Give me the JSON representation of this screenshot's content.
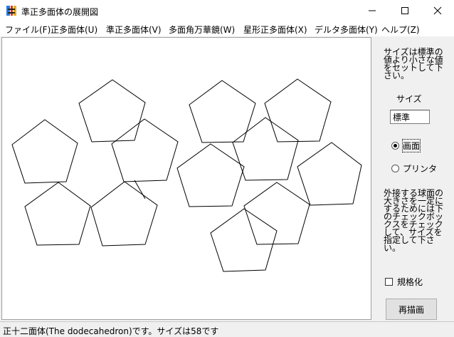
{
  "window": {
    "title": "準正多面体の展開図",
    "minimize_icon": "minimize-icon",
    "maximize_icon": "maximize-icon",
    "close_icon": "close-icon"
  },
  "menu": [
    {
      "label": "ファイル(F)"
    },
    {
      "label": "正多面体(U)"
    },
    {
      "label": "準正多面体(V)"
    },
    {
      "label": "多面角万華鏡(W)"
    },
    {
      "label": "星形正多面体(X)"
    },
    {
      "label": "デルタ多面体(Y)"
    },
    {
      "label": "ヘルプ(Z)"
    }
  ],
  "panel": {
    "size_hint": "サイズは標準の値より小さな値をセットして下さい。",
    "size_label": "サイズ",
    "size_value": "標準",
    "output_options": [
      {
        "label": "画面",
        "checked": true
      },
      {
        "label": "プリンタ",
        "checked": false
      }
    ],
    "normalize_hint": "外接する球面の大きさを一定にするためには下のチェックボックスをチェックして、サイズを指定して下さい。",
    "normalize_label": "規格化",
    "normalize_checked": false,
    "redraw_label": "再描画"
  },
  "status": {
    "text": "正十二面体(The dodecahedron)です。サイズは58です"
  },
  "net": {
    "shape": "dodecahedron",
    "face_count": 12,
    "edge_length": 58
  },
  "colors": {
    "line": "#000000",
    "canvas": "#ffffff",
    "panel": "#f0f0f0"
  }
}
